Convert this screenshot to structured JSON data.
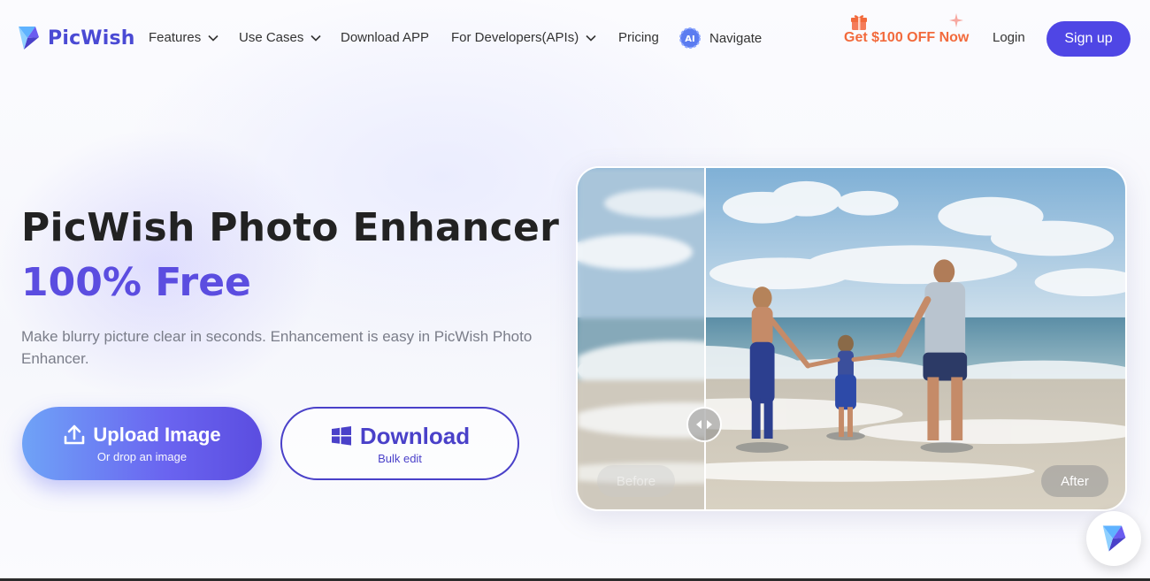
{
  "brand": {
    "name": "PicWish"
  },
  "nav": {
    "items": [
      {
        "label": "Features",
        "has_dropdown": true
      },
      {
        "label": "Use Cases",
        "has_dropdown": true
      },
      {
        "label": "Download APP",
        "has_dropdown": false
      },
      {
        "label": "For Developers(APIs)",
        "has_dropdown": true
      },
      {
        "label": "Pricing",
        "has_dropdown": false
      },
      {
        "label": "Navigate",
        "has_dropdown": false,
        "badge": "AI"
      }
    ],
    "promo": "Get $100 OFF Now",
    "login": "Login",
    "signup": "Sign up"
  },
  "hero": {
    "title": "PicWish Photo Enhancer",
    "subtitle": "100% Free",
    "description": "Make blurry picture clear in seconds. Enhancement is easy in PicWish Photo Enhancer.",
    "upload_button": {
      "label": "Upload Image",
      "sublabel": "Or drop an image"
    },
    "download_button": {
      "label": "Download",
      "sublabel": "Bulk edit"
    }
  },
  "compare": {
    "before_label": "Before",
    "after_label": "After"
  },
  "colors": {
    "brand_purple": "#4f46e5",
    "accent_text": "#5b4de0",
    "promo_orange": "#f26a3c"
  }
}
